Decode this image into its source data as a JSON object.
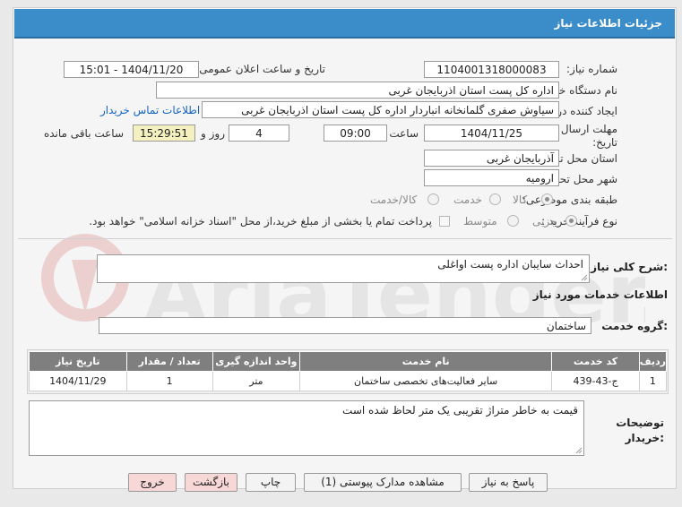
{
  "header": {
    "title": "جزئیات اطلاعات نیاز"
  },
  "form": {
    "need_number_label": "شماره نیاز:",
    "need_number": "1104001318000083",
    "announce_label": "تاریخ و ساعت اعلان عمومی:",
    "announce_value": "1404/11/20 - 15:01",
    "buyer_label": "نام دستگاه خریدار:",
    "buyer_value": "اداره کل پست استان اذربایجان غربی",
    "creator_label": "ایجاد کننده درخواست:",
    "creator_value": "سیاوش صفری گلمانخانه انباردار اداره کل پست استان اذربایجان غربی",
    "contact_link": "اطلاعات تماس خریدار",
    "deadline_label": "مهلت ارسال پاسخ: تا تاریخ:",
    "deadline_date": "1404/11/25",
    "time_label": "ساعت",
    "deadline_time": "09:00",
    "days_value": "4",
    "days_label": "روز و",
    "remaining_time": "15:29:51",
    "remaining_label": "ساعت باقی مانده",
    "province_label": "استان محل تحویل:",
    "province_value": "آذربایجان غربی",
    "city_label": "شهر محل تحویل:",
    "city_value": "ارومیه",
    "category_label": "طبقه بندی موضوعی:",
    "category_options": [
      "کالا",
      "خدمت",
      "کالا/خدمت"
    ],
    "process_label": "نوع فرآیند خرید :",
    "process_options": [
      "جزیی",
      "متوسط"
    ],
    "process_note": "پرداخت تمام یا بخشی از مبلغ خرید،از محل \"اسناد خزانه اسلامی\" خواهد بود."
  },
  "summary": {
    "label": "شرح کلی نیاز:",
    "value": "احداث سایبان اداره پست اواغلی"
  },
  "services": {
    "section_title": "اطلاعات خدمات مورد نیاز",
    "group_label": "گروه خدمت:",
    "group_value": "ساختمان",
    "columns": [
      "ردیف",
      "کد خدمت",
      "نام خدمت",
      "واحد اندازه گیری",
      "تعداد / مقدار",
      "تاریخ نیاز"
    ],
    "rows": [
      {
        "row": "1",
        "code": "ج-43-439",
        "name": "سایر فعالیت‌های تخصصی ساختمان",
        "unit": "متر",
        "qty": "1",
        "date": "1404/11/29"
      }
    ]
  },
  "notes": {
    "label": "توضیحات خریدار:",
    "value": "قیمت به خاطر متراژ تقریبی یک متر لحاظ شده است"
  },
  "buttons": {
    "reply": "پاسخ به نیاز",
    "attachments": "مشاهده مدارک پیوستی (1)",
    "print": "چاپ",
    "back": "بازگشت",
    "exit": "خروج"
  },
  "watermark": "AriaTender.neT",
  "colors": {
    "header": "#3a8dc8",
    "table_header": "#7f7f7f",
    "link": "#1565c0",
    "highlight": "#f4f0c0"
  }
}
